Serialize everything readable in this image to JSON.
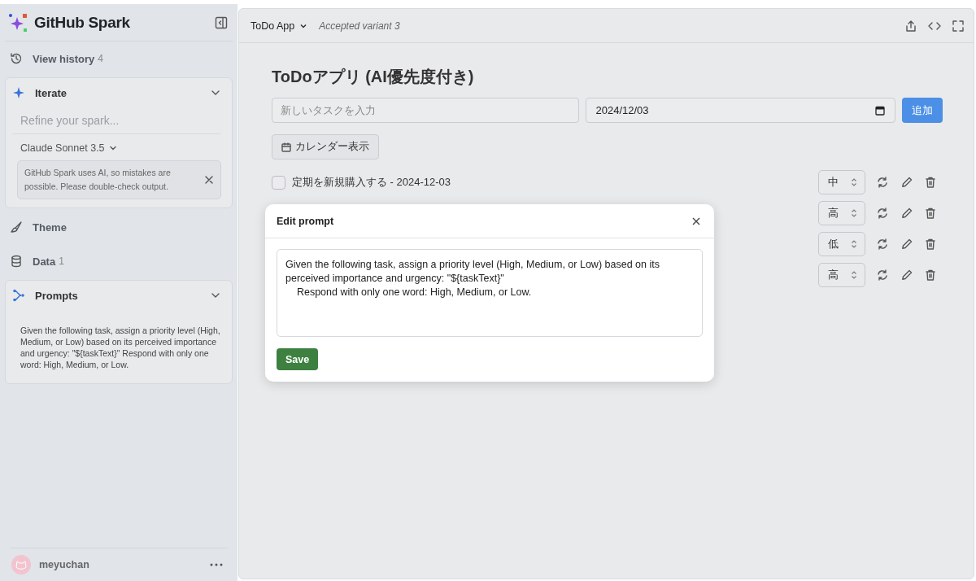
{
  "sidebar": {
    "brand": "GitHub Spark",
    "history": {
      "label": "View history",
      "count": "4"
    },
    "iterate": {
      "title": "Iterate",
      "expanded": true,
      "placeholder": "Refine your spark...",
      "model": "Claude Sonnet 3.5",
      "notice": "GitHub Spark uses AI, so mistakes are possible. Please double-check output."
    },
    "theme": {
      "label": "Theme"
    },
    "data": {
      "label": "Data",
      "count": "1"
    },
    "prompts": {
      "title": "Prompts",
      "expanded": true,
      "text": "Given the following task, assign a priority level (High, Medium, or Low) based on its perceived importance and urgency: \"${taskText}\" Respond with only one word: High, Medium, or Low."
    },
    "user": {
      "name": "meyuchan"
    }
  },
  "header": {
    "app_name": "ToDo App",
    "variant": "Accepted variant 3"
  },
  "app": {
    "title": "ToDoアプリ (AI優先度付き)",
    "task_input": {
      "placeholder": "新しいタスクを入力"
    },
    "date_input": {
      "value": "2024/12/03"
    },
    "add_button": "追加",
    "calendar_button": "カレンダー表示",
    "tasks": [
      {
        "text": "定期を新規購入する - 2024-12-03",
        "checked": false,
        "priority": "中"
      },
      {
        "priority": "高"
      },
      {
        "priority": "低"
      },
      {
        "priority": "高"
      }
    ]
  },
  "modal": {
    "title": "Edit prompt",
    "text": "Given the following task, assign a priority level (High, Medium, or Low) based on its perceived importance and urgency: \"${taskText}\"\n    Respond with only one word: High, Medium, or Low.",
    "save_button": "Save"
  }
}
